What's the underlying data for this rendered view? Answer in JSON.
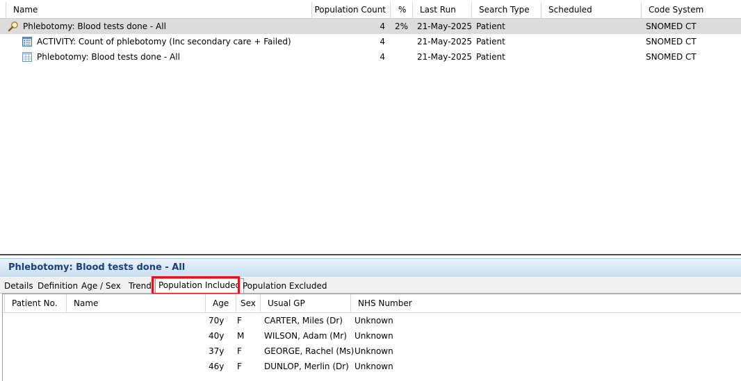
{
  "top_table": {
    "columns": {
      "name": "Name",
      "population_count": "Population Count",
      "percent": "%",
      "last_run": "Last Run",
      "search_type": "Search Type",
      "scheduled": "Scheduled",
      "code_system": "Code System"
    },
    "rows": [
      {
        "name": "Phlebotomy: Blood tests done - All",
        "population_count": "4",
        "percent": "2%",
        "last_run": "21-May-2025",
        "search_type": "Patient",
        "scheduled": "",
        "code_system": "SNOMED CT",
        "icon": "search-magnifier-icon",
        "selected": true
      },
      {
        "name": "ACTIVITY: Count of phlebotomy (Inc secondary care + Failed)",
        "population_count": "4",
        "percent": "",
        "last_run": "21-May-2025",
        "search_type": "Patient",
        "scheduled": "",
        "code_system": "SNOMED CT",
        "icon": "report-list-icon",
        "selected": false
      },
      {
        "name": "Phlebotomy: Blood tests done - All",
        "population_count": "4",
        "percent": "",
        "last_run": "21-May-2025",
        "search_type": "Patient",
        "scheduled": "",
        "code_system": "SNOMED CT",
        "icon": "table-grid-icon",
        "selected": false
      }
    ]
  },
  "detail_panel": {
    "title": "Phlebotomy: Blood tests done - All",
    "tabs": [
      "Details",
      "Definition",
      "Age / Sex",
      "Trend",
      "Population Included",
      "Population Excluded"
    ],
    "active_tab": "Population Included",
    "highlight_color": "#e0141e",
    "columns": {
      "patient_no": "Patient No.",
      "name": "Name",
      "age": "Age",
      "sex": "Sex",
      "usual_gp": "Usual GP",
      "nhs_number": "NHS Number"
    },
    "rows": [
      {
        "patient_no": "",
        "name": "",
        "age": "70y",
        "sex": "F",
        "usual_gp": "CARTER, Miles (Dr)",
        "nhs_number": "Unknown"
      },
      {
        "patient_no": "",
        "name": "",
        "age": "40y",
        "sex": "M",
        "usual_gp": "WILSON, Adam (Mr)",
        "nhs_number": "Unknown"
      },
      {
        "patient_no": "",
        "name": "",
        "age": "37y",
        "sex": "F",
        "usual_gp": "GEORGE, Rachel (Ms)",
        "nhs_number": "Unknown"
      },
      {
        "patient_no": "",
        "name": "",
        "age": "46y",
        "sex": "F",
        "usual_gp": "DUNLOP, Merlin (Dr)",
        "nhs_number": "Unknown"
      }
    ]
  }
}
